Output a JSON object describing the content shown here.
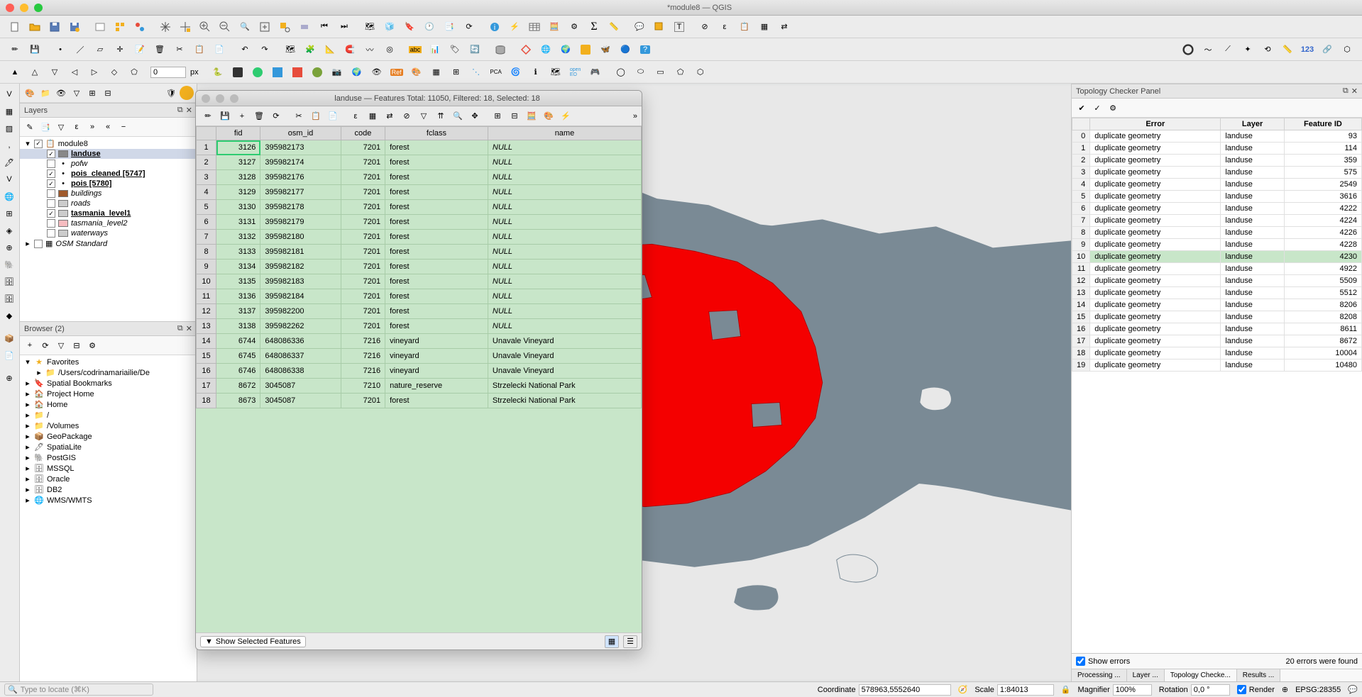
{
  "window": {
    "title": "*module8 — QGIS"
  },
  "layers_panel": {
    "title": "Layers",
    "root_group": "module8",
    "items": [
      {
        "name": "landuse",
        "checked": true,
        "bold": true,
        "underline": true,
        "color": "#888",
        "selected": true
      },
      {
        "name": "pofw",
        "checked": false,
        "italic": true,
        "bullet": true
      },
      {
        "name": "pois_cleaned [5747]",
        "checked": true,
        "bold": true,
        "bullet": true
      },
      {
        "name": "pois [5780]",
        "checked": true,
        "bold": true,
        "bullet": true
      },
      {
        "name": "buildings",
        "checked": false,
        "italic": true,
        "color": "#a05a2c"
      },
      {
        "name": "roads",
        "checked": false,
        "italic": true
      },
      {
        "name": "tasmania_level1",
        "checked": true,
        "bold": true
      },
      {
        "name": "tasmania_level2",
        "checked": false,
        "italic": true,
        "color": "#f7bcc0"
      },
      {
        "name": "waterways",
        "checked": false,
        "italic": true
      }
    ],
    "osm_layer": "OSM Standard"
  },
  "browser_panel": {
    "title": "Browser (2)",
    "items": [
      {
        "icon": "★",
        "name": "Favorites",
        "expanded": true,
        "color": "#f2b01e"
      },
      {
        "icon": "📁",
        "name": "/Users/codrinamariailie/De",
        "indent": 1
      },
      {
        "icon": "🔖",
        "name": "Spatial Bookmarks"
      },
      {
        "icon": "🏠",
        "name": "Project Home",
        "color": "#7aa23a"
      },
      {
        "icon": "🏠",
        "name": "Home"
      },
      {
        "icon": "📁",
        "name": "/"
      },
      {
        "icon": "📁",
        "name": "/Volumes"
      },
      {
        "icon": "📦",
        "name": "GeoPackage"
      },
      {
        "icon": "🖊",
        "name": "SpatiaLite"
      },
      {
        "icon": "🐘",
        "name": "PostGIS"
      },
      {
        "icon": "🗄",
        "name": "MSSQL"
      },
      {
        "icon": "🗄",
        "name": "Oracle"
      },
      {
        "icon": "🗄",
        "name": "DB2"
      },
      {
        "icon": "🌐",
        "name": "WMS/WMTS"
      }
    ]
  },
  "attribute_table": {
    "title": "landuse — Features Total: 11050, Filtered: 18, Selected: 18",
    "columns": [
      "fid",
      "osm_id",
      "code",
      "fclass",
      "name"
    ],
    "rows": [
      {
        "n": 1,
        "fid": 3126,
        "osm_id": "395982173",
        "code": 7201,
        "fclass": "forest",
        "name": "NULL",
        "cursor": true
      },
      {
        "n": 2,
        "fid": 3127,
        "osm_id": "395982174",
        "code": 7201,
        "fclass": "forest",
        "name": "NULL"
      },
      {
        "n": 3,
        "fid": 3128,
        "osm_id": "395982176",
        "code": 7201,
        "fclass": "forest",
        "name": "NULL"
      },
      {
        "n": 4,
        "fid": 3129,
        "osm_id": "395982177",
        "code": 7201,
        "fclass": "forest",
        "name": "NULL"
      },
      {
        "n": 5,
        "fid": 3130,
        "osm_id": "395982178",
        "code": 7201,
        "fclass": "forest",
        "name": "NULL"
      },
      {
        "n": 6,
        "fid": 3131,
        "osm_id": "395982179",
        "code": 7201,
        "fclass": "forest",
        "name": "NULL"
      },
      {
        "n": 7,
        "fid": 3132,
        "osm_id": "395982180",
        "code": 7201,
        "fclass": "forest",
        "name": "NULL"
      },
      {
        "n": 8,
        "fid": 3133,
        "osm_id": "395982181",
        "code": 7201,
        "fclass": "forest",
        "name": "NULL"
      },
      {
        "n": 9,
        "fid": 3134,
        "osm_id": "395982182",
        "code": 7201,
        "fclass": "forest",
        "name": "NULL"
      },
      {
        "n": 10,
        "fid": 3135,
        "osm_id": "395982183",
        "code": 7201,
        "fclass": "forest",
        "name": "NULL"
      },
      {
        "n": 11,
        "fid": 3136,
        "osm_id": "395982184",
        "code": 7201,
        "fclass": "forest",
        "name": "NULL"
      },
      {
        "n": 12,
        "fid": 3137,
        "osm_id": "395982200",
        "code": 7201,
        "fclass": "forest",
        "name": "NULL"
      },
      {
        "n": 13,
        "fid": 3138,
        "osm_id": "395982262",
        "code": 7201,
        "fclass": "forest",
        "name": "NULL"
      },
      {
        "n": 14,
        "fid": 6744,
        "osm_id": "648086336",
        "code": 7216,
        "fclass": "vineyard",
        "name": "Unavale Vineyard"
      },
      {
        "n": 15,
        "fid": 6745,
        "osm_id": "648086337",
        "code": 7216,
        "fclass": "vineyard",
        "name": "Unavale Vineyard"
      },
      {
        "n": 16,
        "fid": 6746,
        "osm_id": "648086338",
        "code": 7216,
        "fclass": "vineyard",
        "name": "Unavale Vineyard"
      },
      {
        "n": 17,
        "fid": 8672,
        "osm_id": "3045087",
        "code": 7210,
        "fclass": "nature_reserve",
        "name": "Strzelecki National Park"
      },
      {
        "n": 18,
        "fid": 8673,
        "osm_id": "3045087",
        "code": 7201,
        "fclass": "forest",
        "name": "Strzelecki National Park"
      }
    ],
    "filter_label": "Show Selected Features"
  },
  "topo_panel": {
    "title": "Topology Checker Panel",
    "columns": [
      "Error",
      "Layer",
      "Feature ID"
    ],
    "rows": [
      {
        "n": 0,
        "error": "duplicate geometry",
        "layer": "landuse",
        "fid": 93
      },
      {
        "n": 1,
        "error": "duplicate geometry",
        "layer": "landuse",
        "fid": 114
      },
      {
        "n": 2,
        "error": "duplicate geometry",
        "layer": "landuse",
        "fid": 359
      },
      {
        "n": 3,
        "error": "duplicate geometry",
        "layer": "landuse",
        "fid": 575
      },
      {
        "n": 4,
        "error": "duplicate geometry",
        "layer": "landuse",
        "fid": 2549
      },
      {
        "n": 5,
        "error": "duplicate geometry",
        "layer": "landuse",
        "fid": 3616
      },
      {
        "n": 6,
        "error": "duplicate geometry",
        "layer": "landuse",
        "fid": 4222
      },
      {
        "n": 7,
        "error": "duplicate geometry",
        "layer": "landuse",
        "fid": 4224
      },
      {
        "n": 8,
        "error": "duplicate geometry",
        "layer": "landuse",
        "fid": 4226
      },
      {
        "n": 9,
        "error": "duplicate geometry",
        "layer": "landuse",
        "fid": 4228
      },
      {
        "n": 10,
        "error": "duplicate geometry",
        "layer": "landuse",
        "fid": 4230,
        "hl": true
      },
      {
        "n": 11,
        "error": "duplicate geometry",
        "layer": "landuse",
        "fid": 4922
      },
      {
        "n": 12,
        "error": "duplicate geometry",
        "layer": "landuse",
        "fid": 5509
      },
      {
        "n": 13,
        "error": "duplicate geometry",
        "layer": "landuse",
        "fid": 5512
      },
      {
        "n": 14,
        "error": "duplicate geometry",
        "layer": "landuse",
        "fid": 8206
      },
      {
        "n": 15,
        "error": "duplicate geometry",
        "layer": "landuse",
        "fid": 8208
      },
      {
        "n": 16,
        "error": "duplicate geometry",
        "layer": "landuse",
        "fid": 8611
      },
      {
        "n": 17,
        "error": "duplicate geometry",
        "layer": "landuse",
        "fid": 8672
      },
      {
        "n": 18,
        "error": "duplicate geometry",
        "layer": "landuse",
        "fid": 10004
      },
      {
        "n": 19,
        "error": "duplicate geometry",
        "layer": "landuse",
        "fid": 10480
      }
    ],
    "show_errors_label": "Show errors",
    "summary": "20 errors were found",
    "tabs": [
      "Processing ...",
      "Layer ...",
      "Topology Checke...",
      "Results ..."
    ]
  },
  "statusbar": {
    "locator_placeholder": "Type to locate (⌘K)",
    "coord_label": "Coordinate",
    "coord_value": "578963,5552640",
    "scale_label": "Scale",
    "scale_value": "1:84013",
    "magnifier_label": "Magnifier",
    "magnifier_value": "100%",
    "rotation_label": "Rotation",
    "rotation_value": "0,0 °",
    "render_label": "Render",
    "crs": "EPSG:28355"
  },
  "px_label": "px"
}
